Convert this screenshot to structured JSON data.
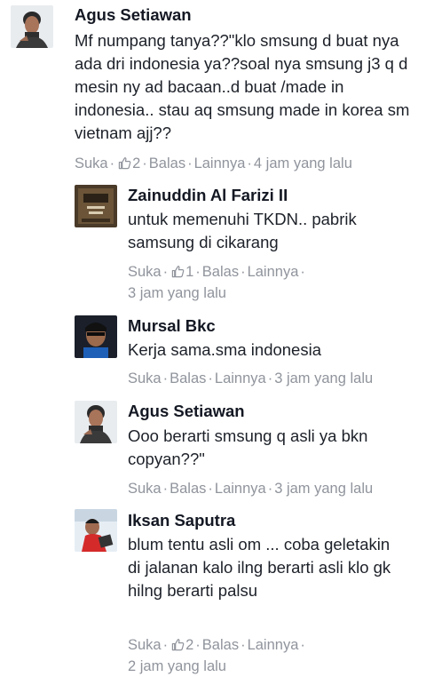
{
  "comments": [
    {
      "author": "Agus Setiawan",
      "text": "Mf numpang tanya??\"klo smsung d buat nya ada dri indonesia ya??soal nya smsung j3 q d mesin ny ad bacaan..d buat /made in indonesia.. stau aq smsung made in korea sm vietnam ajj??",
      "like_label": "Suka",
      "like_count": "2",
      "reply_label": "Balas",
      "more_label": "Lainnya",
      "time": "4 jam yang lalu"
    },
    {
      "author": "Zainuddin Al Farizi II",
      "text": "untuk memenuhi TKDN.. pabrik samsung di cikarang",
      "like_label": "Suka",
      "like_count": "1",
      "reply_label": "Balas",
      "more_label": "Lainnya",
      "time": "3 jam yang lalu"
    },
    {
      "author": "Mursal Bkc",
      "text": "Kerja sama.sma indonesia",
      "like_label": "Suka",
      "reply_label": "Balas",
      "more_label": "Lainnya",
      "time": "3 jam yang lalu"
    },
    {
      "author": "Agus Setiawan",
      "text": "Ooo berarti smsung q asli ya bkn copyan??\"",
      "like_label": "Suka",
      "reply_label": "Balas",
      "more_label": "Lainnya",
      "time": "3 jam yang lalu"
    },
    {
      "author": "Iksan Saputra",
      "text": "blum tentu asli om ... coba geletakin di jalanan kalo ilng berarti asli klo gk hilng berarti palsu",
      "like_label": "Suka",
      "like_count": "2",
      "reply_label": "Balas",
      "more_label": "Lainnya",
      "time": "2 jam yang lalu"
    }
  ],
  "colors": {
    "meta": "#90949c",
    "name": "#141823",
    "text": "#1d2129"
  }
}
